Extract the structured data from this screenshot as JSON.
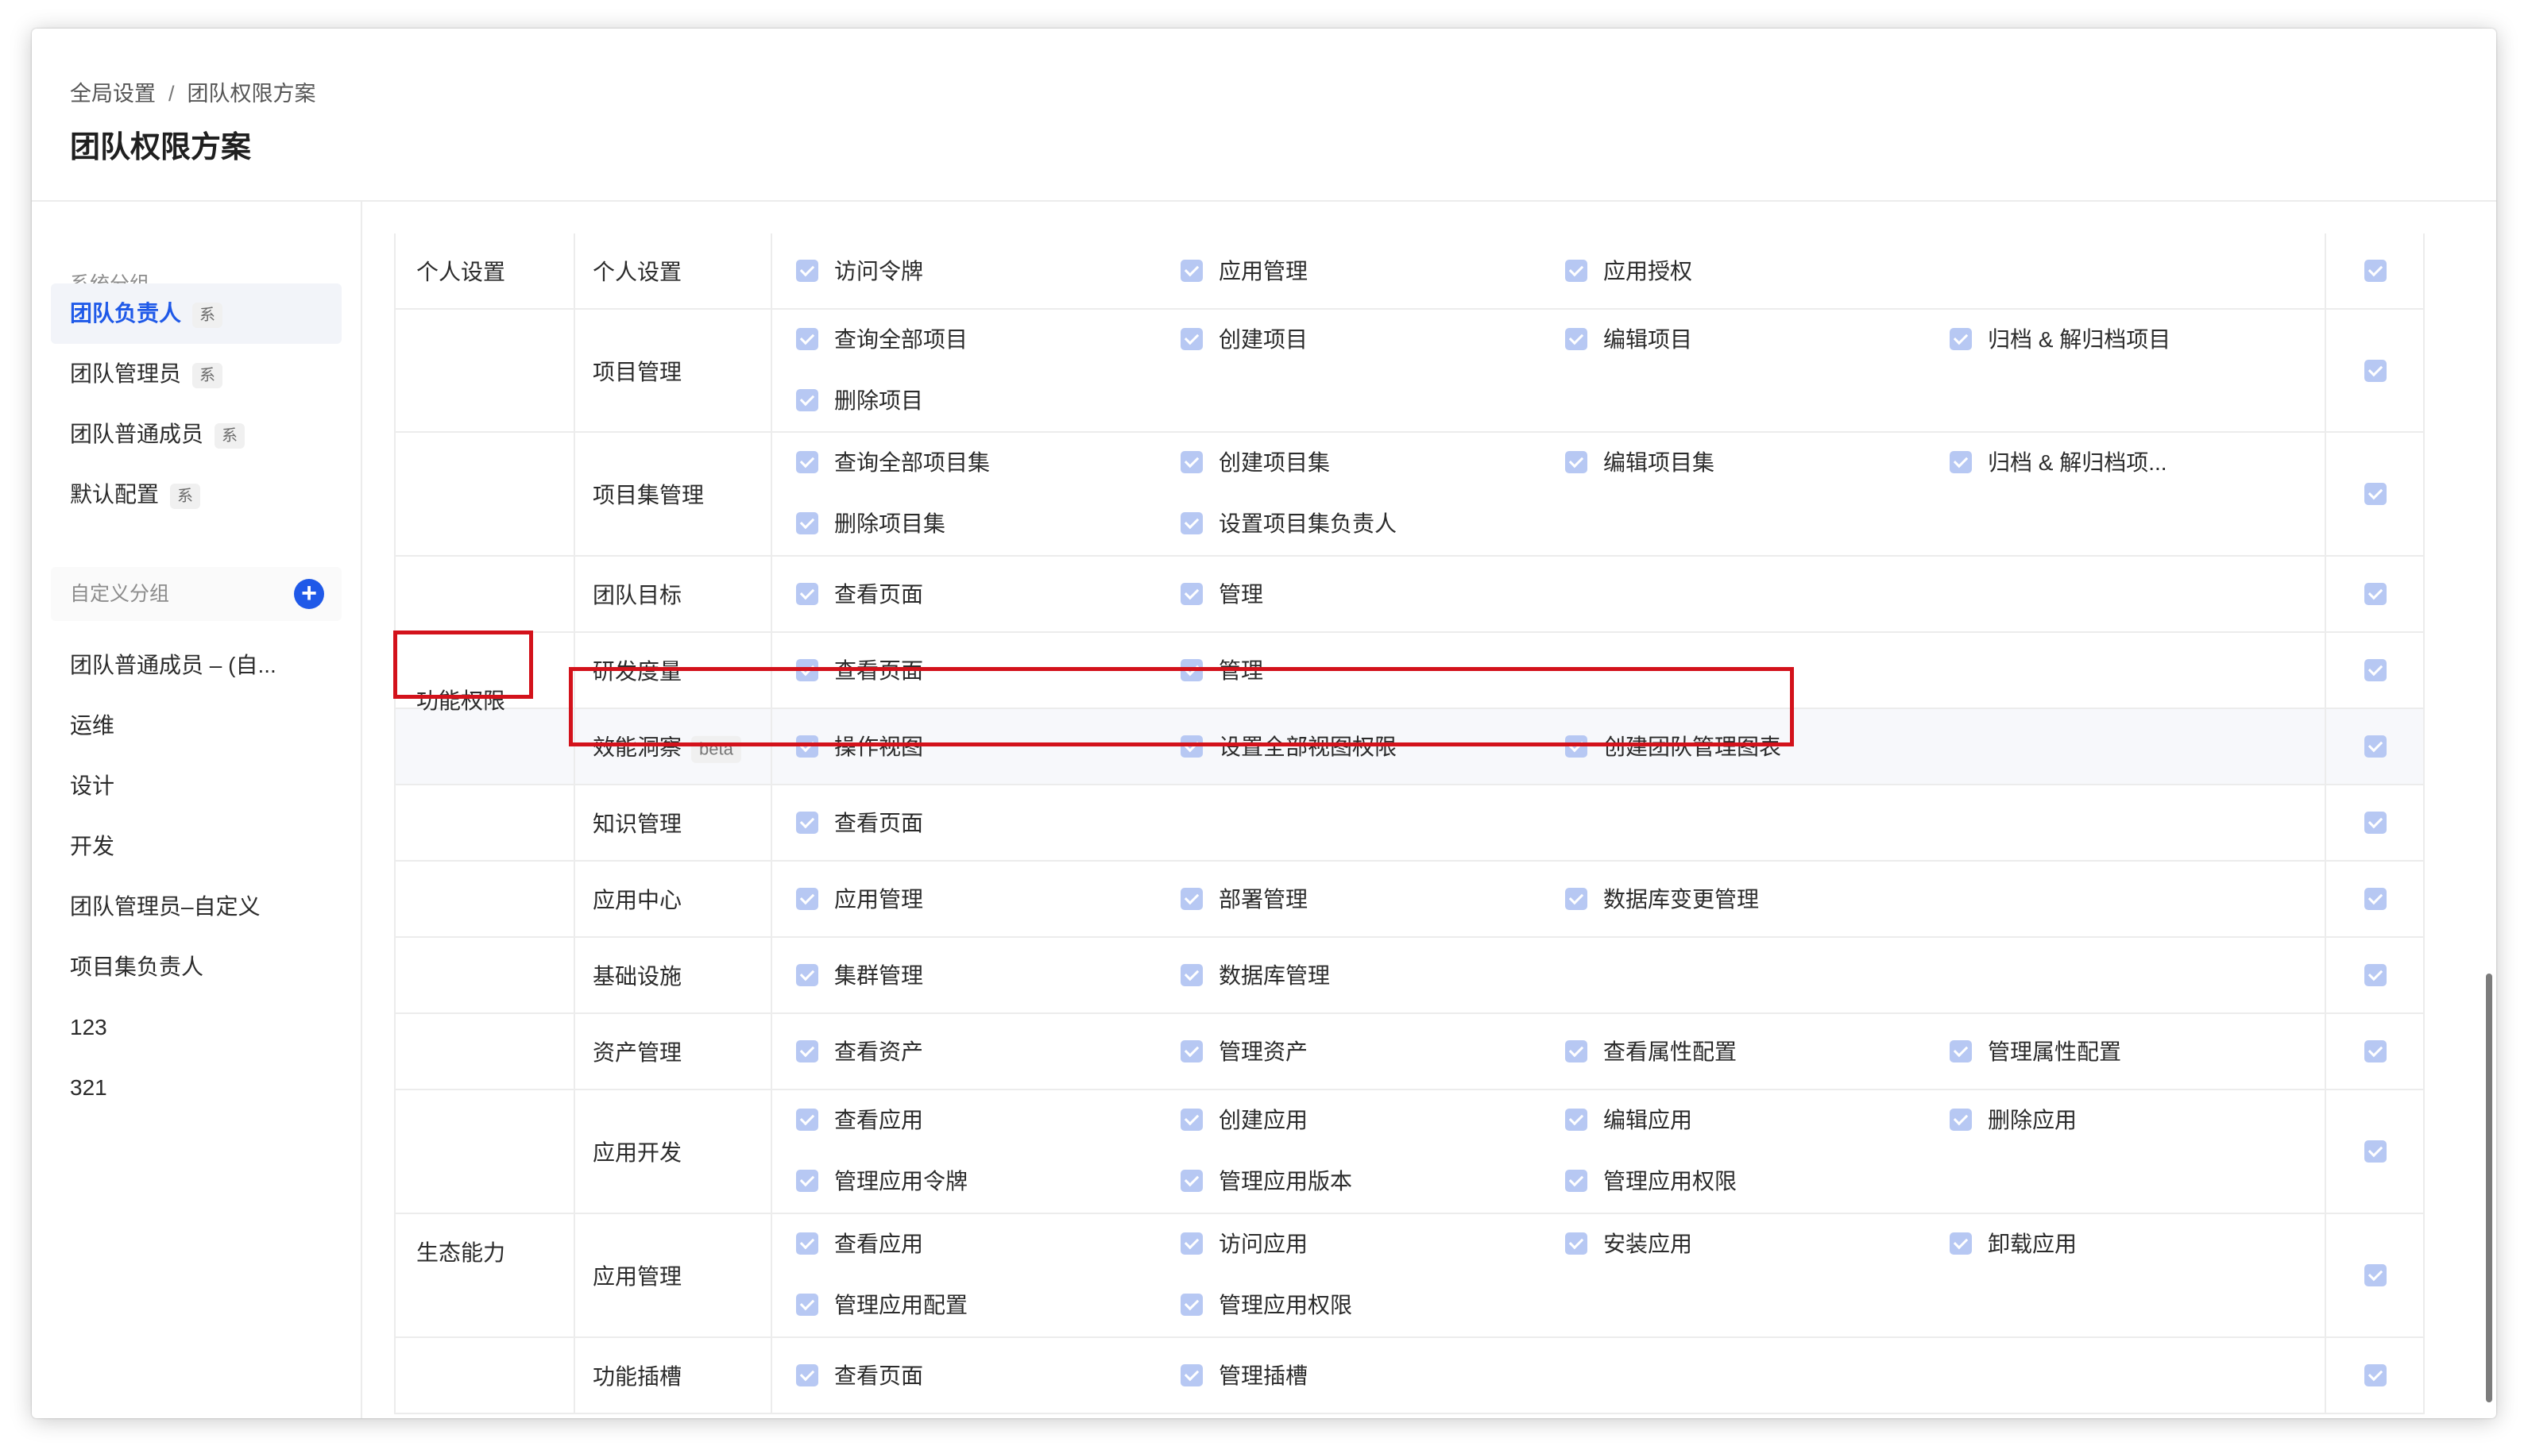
{
  "header": {
    "breadcrumb": [
      "全局设置",
      "团队权限方案"
    ],
    "separator": "/",
    "title": "团队权限方案"
  },
  "sidebar": {
    "system_group_title": "系统分组",
    "system_tag": "系",
    "system_items": [
      "团队负责人",
      "团队管理员",
      "团队普通成员",
      "默认配置"
    ],
    "active_item": "团队负责人",
    "custom_group_title": "自定义分组",
    "custom_items": [
      "团队普通成员 – (自...",
      "运维",
      "设计",
      "开发",
      "团队管理员–自定义",
      "项目集负责人",
      "123",
      "321"
    ]
  },
  "table": {
    "categories": [
      "个人设置",
      "功能权限",
      "生态能力"
    ],
    "beta_tag": "beta",
    "rows": [
      {
        "category": "个人设置",
        "sub": "个人设置",
        "perms": [
          "访问令牌",
          "应用管理",
          "应用授权"
        ]
      },
      {
        "category": "功能权限",
        "sub": "项目管理",
        "perms": [
          "查询全部项目",
          "创建项目",
          "编辑项目",
          "归档 & 解归档项目",
          "删除项目"
        ]
      },
      {
        "category": "功能权限",
        "sub": "项目集管理",
        "perms": [
          "查询全部项目集",
          "创建项目集",
          "编辑项目集",
          "归档 & 解归档项...",
          "删除项目集",
          "设置项目集负责人"
        ]
      },
      {
        "category": "功能权限",
        "sub": "团队目标",
        "perms": [
          "查看页面",
          "管理"
        ]
      },
      {
        "category": "功能权限",
        "sub": "研发度量",
        "perms": [
          "查看页面",
          "管理"
        ]
      },
      {
        "category": "功能权限",
        "sub": "效能洞察",
        "beta": true,
        "perms": [
          "操作视图",
          "设置全部视图权限",
          "创建团队管理图表"
        ]
      },
      {
        "category": "功能权限",
        "sub": "知识管理",
        "perms": [
          "查看页面"
        ]
      },
      {
        "category": "功能权限",
        "sub": "应用中心",
        "perms": [
          "应用管理",
          "部署管理",
          "数据库变更管理"
        ]
      },
      {
        "category": "功能权限",
        "sub": "基础设施",
        "perms": [
          "集群管理",
          "数据库管理"
        ]
      },
      {
        "category": "功能权限",
        "sub": "资产管理",
        "perms": [
          "查看资产",
          "管理资产",
          "查看属性配置",
          "管理属性配置"
        ]
      },
      {
        "category": "生态能力",
        "sub": "应用开发",
        "perms": [
          "查看应用",
          "创建应用",
          "编辑应用",
          "删除应用",
          "管理应用令牌",
          "管理应用版本",
          "管理应用权限"
        ]
      },
      {
        "category": "生态能力",
        "sub": "应用管理",
        "perms": [
          "查看应用",
          "访问应用",
          "安装应用",
          "卸载应用",
          "管理应用配置",
          "管理应用权限"
        ]
      },
      {
        "category": "生态能力",
        "sub": "功能插槽",
        "perms": [
          "查看页面",
          "管理插槽"
        ]
      }
    ]
  },
  "colors": {
    "accent": "#1f59e8",
    "checkbox": "#b7c8f3",
    "highlight_border": "#d3121b",
    "highlight_row": "#f7f8fb"
  }
}
